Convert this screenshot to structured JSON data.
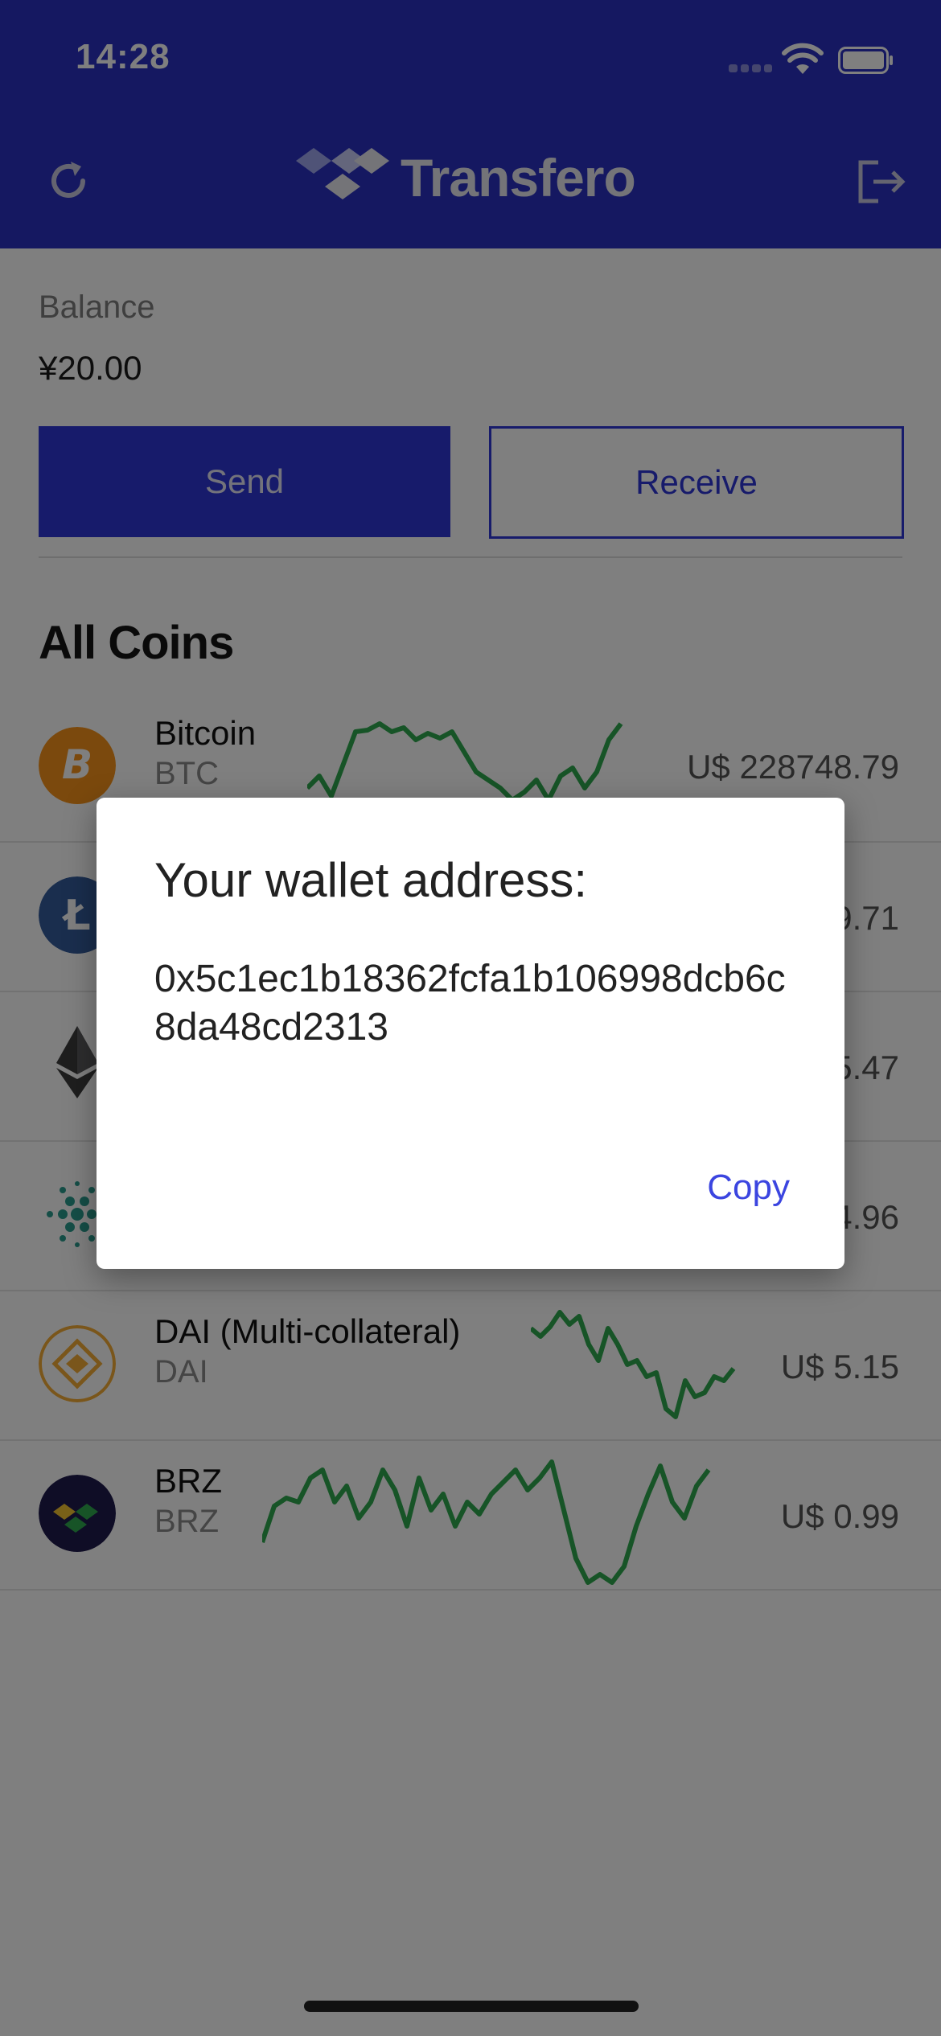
{
  "status_bar": {
    "time": "14:28"
  },
  "header": {
    "brand": "Transfero",
    "icons": [
      "refresh-icon",
      "logo-mark",
      "logout-icon"
    ]
  },
  "balance": {
    "label": "Balance",
    "value": "¥20.00"
  },
  "actions": {
    "send_label": "Send",
    "receive_label": "Receive"
  },
  "coins_section": {
    "title": "All Coins"
  },
  "coins": [
    {
      "name": "Bitcoin",
      "symbol": "BTC",
      "price": "U$ 228748.79",
      "icon": "bitcoin-icon",
      "color": "#f7931a"
    },
    {
      "name": "",
      "symbol": "",
      "price": "9.71",
      "icon": "litecoin-icon",
      "color": "#345d9d"
    },
    {
      "name": "",
      "symbol": "",
      "price": "5.47",
      "icon": "ethereum-icon",
      "color": "#3c3c3d"
    },
    {
      "name": "",
      "symbol": "",
      "price": "4.96",
      "icon": "cardano-icon",
      "color": "#2a9d8f"
    },
    {
      "name": "DAI (Multi-collateral)",
      "symbol": "DAI",
      "price": "U$ 5.15",
      "icon": "dai-icon",
      "color": "#f5ac37"
    },
    {
      "name": "BRZ",
      "symbol": "BRZ",
      "price": "U$ 0.99",
      "icon": "brz-icon",
      "color": "#1e1a4d"
    }
  ],
  "modal": {
    "title": "Your wallet address:",
    "address": "0x5c1ec1b18362fcfa1b106998dcb6c8da48cd2313",
    "copy_label": "Copy"
  },
  "colors": {
    "brand_blue": "#2a30c2",
    "button_blue": "#2f36d6",
    "spark_green": "#2fa84f",
    "link_blue": "#3b45e0"
  }
}
